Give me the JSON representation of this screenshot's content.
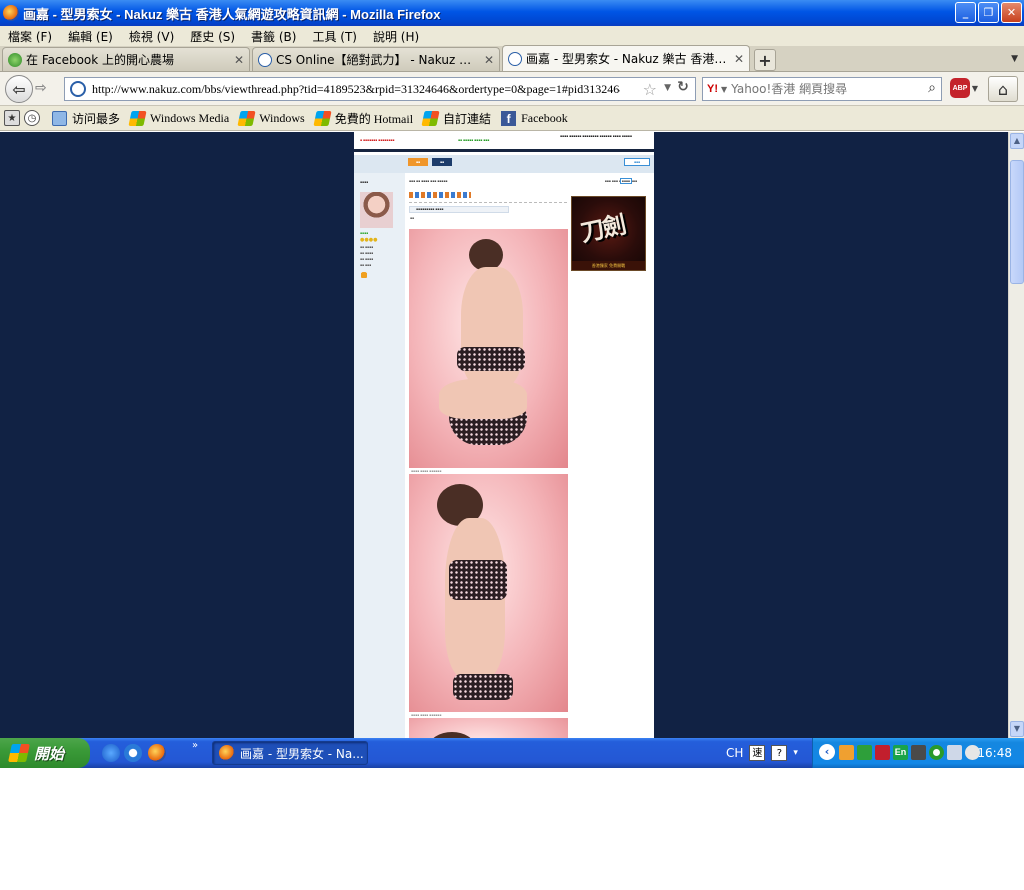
{
  "window": {
    "title": "画嘉 - 型男索女 - Nakuz 樂古 香港人氣網遊攻略資訊網 - Mozilla Firefox",
    "buttons": {
      "minimize": "_",
      "restore": "❐",
      "close": "✕"
    }
  },
  "menu": [
    "檔案 (F)",
    "編輯 (E)",
    "檢視 (V)",
    "歷史 (S)",
    "書籤 (B)",
    "工具 (T)",
    "說明 (H)"
  ],
  "tabs": [
    {
      "label": "在 Facebook 上的開心農場",
      "icon": "farm-icon",
      "active": false
    },
    {
      "label": "CS Online【絕對武力】 - Nakuz 樂古 …",
      "icon": "page-icon",
      "active": false
    },
    {
      "label": "画嘉 - 型男索女 - Nakuz 樂古 香港人…",
      "icon": "page-icon",
      "active": true
    }
  ],
  "nav": {
    "url": "http://www.nakuz.com/bbs/viewthread.php?tid=4189523&rpid=31324646&ordertype=0&page=1#pid31324646",
    "search_placeholder": "Yahoo!香港 網頁搜尋",
    "abp_label": "ABP"
  },
  "bookmarks": [
    {
      "label": "访问最多",
      "icon": "folder-icon"
    },
    {
      "label": "Windows Media",
      "icon": "windows-flag-icon"
    },
    {
      "label": "Windows",
      "icon": "windows-flag-icon"
    },
    {
      "label": "免費的 Hotmail",
      "icon": "windows-flag-icon"
    },
    {
      "label": "自訂連結",
      "icon": "windows-flag-icon"
    },
    {
      "label": "Facebook",
      "icon": "facebook-icon"
    }
  ],
  "page": {
    "colors": {
      "background": "#112244",
      "content": "#ffffff",
      "sidebar": "#e9f0f6"
    },
    "ad": {
      "title": "刀劍",
      "footer": "香港獨家 免費開戰"
    }
  },
  "taskbar": {
    "start_label": "開始",
    "task_label": "画嘉 - 型男索女 - Na...",
    "lang": "CH",
    "clock": "16:48"
  }
}
